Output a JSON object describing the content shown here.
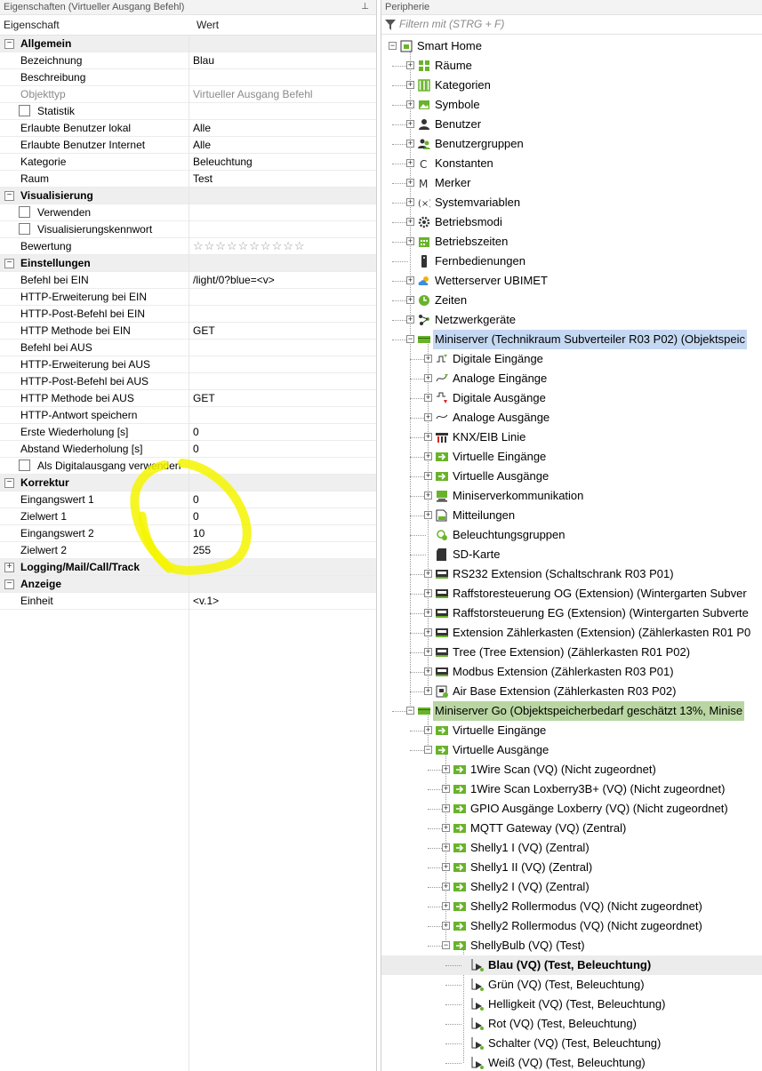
{
  "left_panel": {
    "title": "Eigenschaften (Virtueller Ausgang Befehl)",
    "pin_glyph": "⊥",
    "columns": {
      "property": "Eigenschaft",
      "value": "Wert"
    },
    "rows": [
      {
        "type": "cat",
        "label": "Allgemein",
        "expander": "−"
      },
      {
        "type": "prop",
        "label": "Bezeichnung",
        "value": "Blau"
      },
      {
        "type": "prop",
        "label": "Beschreibung",
        "value": ""
      },
      {
        "type": "prop",
        "label": "Objekttyp",
        "value": "Virtueller Ausgang Befehl",
        "grey": true
      },
      {
        "type": "check",
        "label": "Statistik"
      },
      {
        "type": "prop",
        "label": "Erlaubte Benutzer lokal",
        "value": "Alle"
      },
      {
        "type": "prop",
        "label": "Erlaubte Benutzer Internet",
        "value": "Alle"
      },
      {
        "type": "prop",
        "label": "Kategorie",
        "value": "Beleuchtung"
      },
      {
        "type": "prop",
        "label": "Raum",
        "value": "Test"
      },
      {
        "type": "cat",
        "label": "Visualisierung",
        "expander": "−"
      },
      {
        "type": "check",
        "label": "Verwenden"
      },
      {
        "type": "check",
        "label": "Visualisierungskennwort"
      },
      {
        "type": "prop",
        "label": "Bewertung",
        "value": "☆☆☆☆☆☆☆☆☆☆",
        "stars": true
      },
      {
        "type": "cat",
        "label": "Einstellungen",
        "expander": "−"
      },
      {
        "type": "prop",
        "label": "Befehl bei EIN",
        "value": "/light/0?blue=<v>"
      },
      {
        "type": "prop",
        "label": "HTTP-Erweiterung bei EIN",
        "value": ""
      },
      {
        "type": "prop",
        "label": "HTTP-Post-Befehl bei EIN",
        "value": ""
      },
      {
        "type": "prop",
        "label": "HTTP Methode bei EIN",
        "value": "GET"
      },
      {
        "type": "prop",
        "label": "Befehl bei AUS",
        "value": ""
      },
      {
        "type": "prop",
        "label": "HTTP-Erweiterung bei AUS",
        "value": ""
      },
      {
        "type": "prop",
        "label": "HTTP-Post-Befehl bei AUS",
        "value": ""
      },
      {
        "type": "prop",
        "label": "HTTP Methode bei AUS",
        "value": "GET"
      },
      {
        "type": "prop",
        "label": "HTTP-Antwort speichern",
        "value": ""
      },
      {
        "type": "prop",
        "label": "Erste Wiederholung [s]",
        "value": "0"
      },
      {
        "type": "prop",
        "label": "Abstand Wiederholung [s]",
        "value": "0"
      },
      {
        "type": "check",
        "label": "Als Digitalausgang verwenden"
      },
      {
        "type": "cat",
        "label": "Korrektur",
        "expander": "−"
      },
      {
        "type": "prop",
        "label": "Eingangswert 1",
        "value": "0"
      },
      {
        "type": "prop",
        "label": "Zielwert 1",
        "value": "0"
      },
      {
        "type": "prop",
        "label": "Eingangswert 2",
        "value": "10"
      },
      {
        "type": "prop",
        "label": "Zielwert 2",
        "value": "255"
      },
      {
        "type": "cat",
        "label": "Logging/Mail/Call/Track",
        "expander": "+"
      },
      {
        "type": "cat",
        "label": "Anzeige",
        "expander": "−"
      },
      {
        "type": "prop",
        "label": "Einheit",
        "value": "<v.1>"
      }
    ]
  },
  "right_panel": {
    "title": "Peripherie",
    "filter_placeholder": "Filtern mit (STRG + F)",
    "tree": [
      {
        "label": "Smart Home",
        "level": 0,
        "expander": "−",
        "icon": "home-icon"
      },
      {
        "label": "Räume",
        "level": 1,
        "expander": "+",
        "icon": "rooms-icon"
      },
      {
        "label": "Kategorien",
        "level": 1,
        "expander": "+",
        "icon": "categories-icon"
      },
      {
        "label": "Symbole",
        "level": 1,
        "expander": "+",
        "icon": "image-icon"
      },
      {
        "label": "Benutzer",
        "level": 1,
        "expander": "+",
        "icon": "user-icon"
      },
      {
        "label": "Benutzergruppen",
        "level": 1,
        "expander": "+",
        "icon": "usergroup-icon"
      },
      {
        "label": "Konstanten",
        "level": 1,
        "expander": "+",
        "icon": "letter-c-icon"
      },
      {
        "label": "Merker",
        "level": 1,
        "expander": "+",
        "icon": "letter-m-icon"
      },
      {
        "label": "Systemvariablen",
        "level": 1,
        "expander": "+",
        "icon": "variable-icon"
      },
      {
        "label": "Betriebsmodi",
        "level": 1,
        "expander": "+",
        "icon": "gear-icon"
      },
      {
        "label": "Betriebszeiten",
        "level": 1,
        "expander": "+",
        "icon": "calendar-icon"
      },
      {
        "label": "Fernbedienungen",
        "level": 1,
        "expander": "",
        "icon": "remote-icon"
      },
      {
        "label": "Wetterserver UBIMET",
        "level": 1,
        "expander": "+",
        "icon": "weather-icon"
      },
      {
        "label": "Zeiten",
        "level": 1,
        "expander": "+",
        "icon": "clock-icon"
      },
      {
        "label": "Netzwerkgeräte",
        "level": 1,
        "expander": "+",
        "icon": "network-icon"
      },
      {
        "label": "Miniserver (Technikraum Subverteiler R03 P02) (Objektspeic",
        "level": 1,
        "expander": "−",
        "icon": "miniserver-icon",
        "selected": "blue"
      },
      {
        "label": "Digitale Eingänge",
        "level": 2,
        "expander": "+",
        "icon": "digital-input-icon"
      },
      {
        "label": "Analoge Eingänge",
        "level": 2,
        "expander": "+",
        "icon": "analog-input-icon"
      },
      {
        "label": "Digitale Ausgänge",
        "level": 2,
        "expander": "+",
        "icon": "digital-output-icon"
      },
      {
        "label": "Analoge Ausgänge",
        "level": 2,
        "expander": "+",
        "icon": "analog-output-icon"
      },
      {
        "label": "KNX/EIB Linie",
        "level": 2,
        "expander": "+",
        "icon": "knx-icon"
      },
      {
        "label": "Virtuelle Eingänge",
        "level": 2,
        "expander": "+",
        "icon": "virtual-input-icon"
      },
      {
        "label": "Virtuelle Ausgänge",
        "level": 2,
        "expander": "+",
        "icon": "virtual-output-icon"
      },
      {
        "label": "Miniserverkommunikation",
        "level": 2,
        "expander": "+",
        "icon": "communication-icon"
      },
      {
        "label": "Mitteilungen",
        "level": 2,
        "expander": "+",
        "icon": "message-icon"
      },
      {
        "label": "Beleuchtungsgruppen",
        "level": 2,
        "expander": "",
        "icon": "lighting-group-icon"
      },
      {
        "label": "SD-Karte",
        "level": 2,
        "expander": "",
        "icon": "sd-card-icon"
      },
      {
        "label": "RS232 Extension (Schaltschrank R03 P01)",
        "level": 2,
        "expander": "+",
        "icon": "extension-icon"
      },
      {
        "label": "Raffstoresteuerung OG (Extension) (Wintergarten Subver",
        "level": 2,
        "expander": "+",
        "icon": "extension-icon"
      },
      {
        "label": "Raffstorsteuerung EG (Extension) (Wintergarten Subverte",
        "level": 2,
        "expander": "+",
        "icon": "extension-icon"
      },
      {
        "label": "Extension Zählerkasten (Extension) (Zählerkasten R01 P0",
        "level": 2,
        "expander": "+",
        "icon": "extension-icon"
      },
      {
        "label": "Tree (Tree Extension) (Zählerkasten R01 P02)",
        "level": 2,
        "expander": "+",
        "icon": "extension-icon"
      },
      {
        "label": "Modbus Extension (Zählerkasten R03 P01)",
        "level": 2,
        "expander": "+",
        "icon": "extension-icon"
      },
      {
        "label": "Air Base Extension (Zählerkasten R03 P02)",
        "level": 2,
        "expander": "+",
        "icon": "air-base-icon"
      },
      {
        "label": "Miniserver Go (Objektspeicherbedarf geschätzt 13%, Minise",
        "level": 1,
        "expander": "−",
        "icon": "miniserver-icon",
        "selected": "green"
      },
      {
        "label": "Virtuelle Eingänge",
        "level": 2,
        "expander": "+",
        "icon": "virtual-input-icon"
      },
      {
        "label": "Virtuelle Ausgänge",
        "level": 2,
        "expander": "−",
        "icon": "virtual-output-icon"
      },
      {
        "label": "1Wire Scan (VQ) (Nicht zugeordnet)",
        "level": 3,
        "expander": "+",
        "icon": "virtual-output-icon"
      },
      {
        "label": "1Wire Scan Loxberry3B+ (VQ) (Nicht zugeordnet)",
        "level": 3,
        "expander": "+",
        "icon": "virtual-output-icon"
      },
      {
        "label": "GPIO Ausgänge Loxberry (VQ) (Nicht zugeordnet)",
        "level": 3,
        "expander": "+",
        "icon": "virtual-output-icon"
      },
      {
        "label": "MQTT Gateway (VQ) (Zentral)",
        "level": 3,
        "expander": "+",
        "icon": "virtual-output-icon"
      },
      {
        "label": "Shelly1 I (VQ) (Zentral)",
        "level": 3,
        "expander": "+",
        "icon": "virtual-output-icon"
      },
      {
        "label": "Shelly1 II (VQ) (Zentral)",
        "level": 3,
        "expander": "+",
        "icon": "virtual-output-icon"
      },
      {
        "label": "Shelly2 I (VQ) (Zentral)",
        "level": 3,
        "expander": "+",
        "icon": "virtual-output-icon"
      },
      {
        "label": "Shelly2 Rollermodus (VQ) (Nicht zugeordnet)",
        "level": 3,
        "expander": "+",
        "icon": "virtual-output-icon"
      },
      {
        "label": "Shelly2 Rollermodus (VQ) (Nicht zugeordnet)",
        "level": 3,
        "expander": "+",
        "icon": "virtual-output-icon"
      },
      {
        "label": "ShellyBulb (VQ) (Test)",
        "level": 3,
        "expander": "−",
        "icon": "virtual-output-icon"
      },
      {
        "label": "Blau (VQ) (Test, Beleuchtung)",
        "level": 4,
        "expander": "",
        "icon": "command-icon",
        "bold": true,
        "selected": "grey"
      },
      {
        "label": "Grün (VQ) (Test, Beleuchtung)",
        "level": 4,
        "expander": "",
        "icon": "command-icon"
      },
      {
        "label": "Helligkeit (VQ) (Test, Beleuchtung)",
        "level": 4,
        "expander": "",
        "icon": "command-icon"
      },
      {
        "label": "Rot (VQ) (Test, Beleuchtung)",
        "level": 4,
        "expander": "",
        "icon": "command-icon"
      },
      {
        "label": "Schalter (VQ) (Test, Beleuchtung)",
        "level": 4,
        "expander": "",
        "icon": "command-icon"
      },
      {
        "label": "Weiß (VQ) (Test, Beleuchtung)",
        "level": 4,
        "expander": "",
        "icon": "command-icon"
      }
    ]
  },
  "colors": {
    "loxone_green": "#69b32a",
    "selection_blue": "#c5d8f2",
    "selection_green": "#b9d6a2",
    "highlighter_yellow": "#f5f500"
  }
}
